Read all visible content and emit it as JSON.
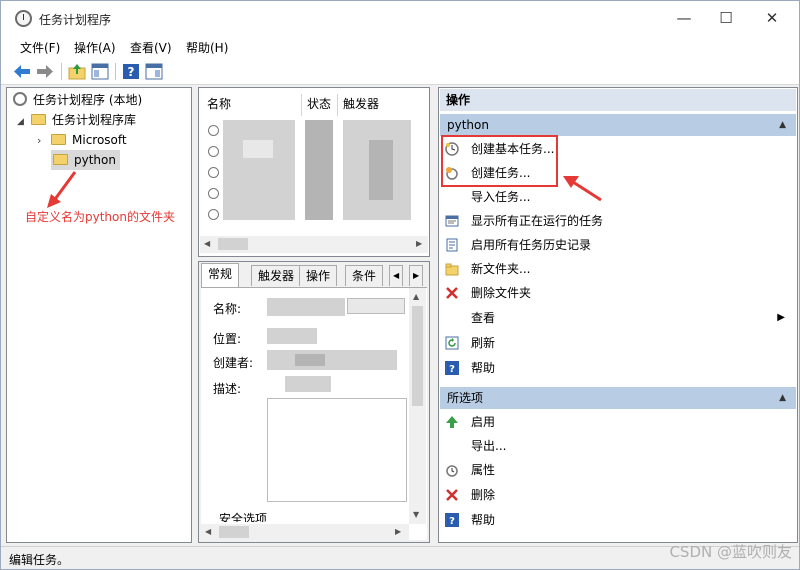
{
  "window": {
    "title": "任务计划程序",
    "minimize": "—",
    "maximize": "☐",
    "close": "✕"
  },
  "menu": [
    "文件(F)",
    "操作(A)",
    "查看(V)",
    "帮助(H)"
  ],
  "tree": {
    "root": "任务计划程序 (本地)",
    "library": "任务计划程序库",
    "children": [
      "Microsoft",
      "python"
    ]
  },
  "task_list": {
    "columns": [
      "名称",
      "状态",
      "触发器"
    ]
  },
  "detail": {
    "tabs": [
      "常规",
      "触发器",
      "操作",
      "条件"
    ],
    "labels": [
      "名称:",
      "位置:",
      "创建者:",
      "描述:"
    ],
    "security_partial": "安全选项"
  },
  "actions": {
    "header": "操作",
    "section1": {
      "title": "python",
      "items": [
        "创建基本任务...",
        "创建任务...",
        "导入任务...",
        "显示所有正在运行的任务",
        "启用所有任务历史记录",
        "新文件夹...",
        "删除文件夹",
        "查看",
        "刷新",
        "帮助"
      ]
    },
    "section2": {
      "title": "所选项",
      "items": [
        "启用",
        "导出...",
        "属性",
        "删除",
        "帮助"
      ]
    }
  },
  "status_bar": "编辑任务。",
  "annotation": "自定义名为python的文件夹",
  "watermark": "CSDN @蓝吹则友",
  "colors": {
    "annotation_red": "#e53935",
    "section_blue": "#b8cce4",
    "header_blue": "#dbe4ef"
  }
}
